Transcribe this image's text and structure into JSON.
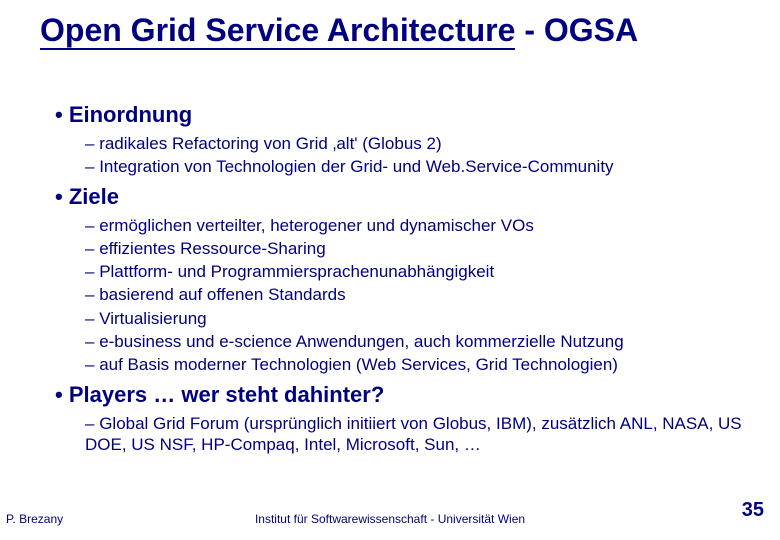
{
  "title_underlined": "Open Grid Service Architecture",
  "title_rest": " - OGSA",
  "sections": [
    {
      "heading": "Einordnung",
      "items": [
        "radikales Refactoring von Grid ‚alt' (Globus 2)",
        "Integration von Technologien der Grid- und Web.Service-Community"
      ]
    },
    {
      "heading": "Ziele",
      "items": [
        "ermöglichen verteilter, heterogener und dynamischer VOs",
        "effizientes Ressource-Sharing",
        "Plattform- und Programmiersprachenunabhängigkeit",
        "basierend auf offenen Standards",
        "Virtualisierung",
        "e-business und e-science Anwendungen, auch kommerzielle Nutzung",
        "auf Basis moderner Technologien (Web Services, Grid Technologien)"
      ]
    },
    {
      "heading": "Players … wer steht dahinter?",
      "items": [
        "Global Grid Forum (ursprünglich initiiert von Globus, IBM), zusätzlich ANL, NASA, US DOE, US NSF, HP-Compaq, Intel, Microsoft, Sun, …"
      ]
    }
  ],
  "footer": {
    "left": "P. Brezany",
    "center": "Institut für Softwarewissenschaft - Universität Wien",
    "page": "35"
  }
}
